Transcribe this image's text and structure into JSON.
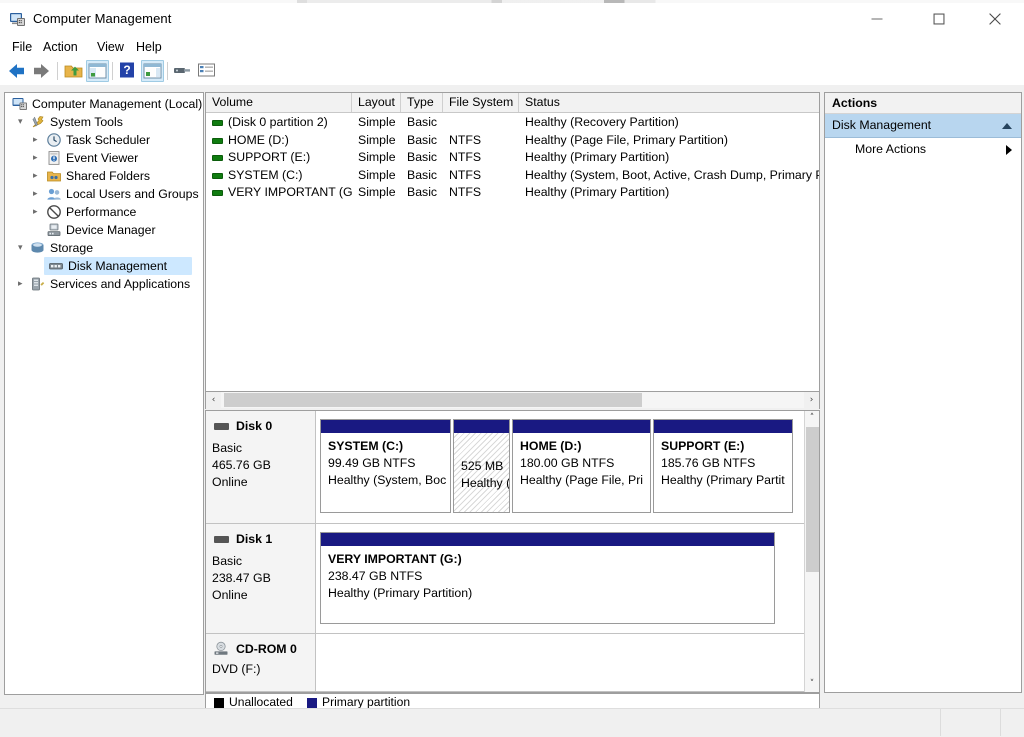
{
  "window": {
    "title": "Computer Management",
    "icon": "computer-management-icon",
    "minimize_label": "—",
    "maximize_label": "□",
    "close_label": "✕"
  },
  "menubar": {
    "items": [
      {
        "label": "File"
      },
      {
        "label": "Action"
      },
      {
        "label": "View"
      },
      {
        "label": "Help"
      }
    ]
  },
  "toolbar": {
    "buttons": [
      {
        "name": "back-icon"
      },
      {
        "name": "forward-icon"
      },
      {
        "name": "up-folder-icon"
      },
      {
        "name": "show-hide-console-tree-icon"
      },
      {
        "name": "help-icon"
      },
      {
        "name": "show-hide-action-pane-icon"
      },
      {
        "name": "properties-icon"
      },
      {
        "name": "list-view-icon"
      }
    ]
  },
  "tree": {
    "root": {
      "label": "Computer Management (Local)",
      "icon": "computer-icon"
    },
    "items": [
      {
        "label": "System Tools",
        "icon": "system-tools-icon",
        "indent": 1,
        "expander": "expanded",
        "selected": false
      },
      {
        "label": "Task Scheduler",
        "icon": "task-scheduler-icon",
        "indent": 2,
        "expander": "collapsed",
        "selected": false
      },
      {
        "label": "Event Viewer",
        "icon": "event-viewer-icon",
        "indent": 2,
        "expander": "collapsed",
        "selected": false
      },
      {
        "label": "Shared Folders",
        "icon": "shared-folders-icon",
        "indent": 2,
        "expander": "collapsed",
        "selected": false
      },
      {
        "label": "Local Users and Groups",
        "icon": "local-users-icon",
        "indent": 2,
        "expander": "collapsed",
        "selected": false
      },
      {
        "label": "Performance",
        "icon": "performance-icon",
        "indent": 2,
        "expander": "collapsed",
        "selected": false
      },
      {
        "label": "Device Manager",
        "icon": "device-manager-icon",
        "indent": 2,
        "expander": "none",
        "selected": false
      },
      {
        "label": "Storage",
        "icon": "storage-icon",
        "indent": 1,
        "expander": "expanded",
        "selected": false
      },
      {
        "label": "Disk Management",
        "icon": "disk-management-icon",
        "indent": 2,
        "expander": "none",
        "selected": true
      },
      {
        "label": "Services and Applications",
        "icon": "services-icon",
        "indent": 1,
        "expander": "collapsed",
        "selected": false
      }
    ]
  },
  "volume_list": {
    "columns": [
      {
        "label": "Volume"
      },
      {
        "label": "Layout"
      },
      {
        "label": "Type"
      },
      {
        "label": "File System"
      },
      {
        "label": "Status"
      }
    ],
    "rows": [
      {
        "volume": "(Disk 0 partition 2)",
        "layout": "Simple",
        "type": "Basic",
        "fs": "",
        "status": "Healthy (Recovery Partition)"
      },
      {
        "volume": "HOME (D:)",
        "layout": "Simple",
        "type": "Basic",
        "fs": "NTFS",
        "status": "Healthy (Page File, Primary Partition)"
      },
      {
        "volume": "SUPPORT (E:)",
        "layout": "Simple",
        "type": "Basic",
        "fs": "NTFS",
        "status": "Healthy (Primary Partition)"
      },
      {
        "volume": "SYSTEM (C:)",
        "layout": "Simple",
        "type": "Basic",
        "fs": "NTFS",
        "status": "Healthy (System, Boot, Active, Crash Dump, Primary P"
      },
      {
        "volume": "VERY IMPORTANT (G:)",
        "layout": "Simple",
        "type": "Basic",
        "fs": "NTFS",
        "status": "Healthy (Primary Partition)"
      }
    ]
  },
  "disks": [
    {
      "name": "Disk 0",
      "type": "Basic",
      "capacity": "465.76 GB",
      "state": "Online",
      "partitions": [
        {
          "name": "SYSTEM  (C:)",
          "size": "99.49 GB NTFS",
          "status": "Healthy (System, Boc",
          "style": "primary"
        },
        {
          "name": "",
          "size": "525 MB",
          "status": "Healthy (F",
          "style": "recovery"
        },
        {
          "name": "HOME  (D:)",
          "size": "180.00 GB NTFS",
          "status": "Healthy (Page File, Pri",
          "style": "primary"
        },
        {
          "name": "SUPPORT  (E:)",
          "size": "185.76 GB NTFS",
          "status": "Healthy (Primary Partit",
          "style": "primary"
        }
      ]
    },
    {
      "name": "Disk 1",
      "type": "Basic",
      "capacity": "238.47 GB",
      "state": "Online",
      "partitions": [
        {
          "name": "VERY IMPORTANT  (G:)",
          "size": "238.47 GB NTFS",
          "status": "Healthy (Primary Partition)",
          "style": "primary"
        }
      ]
    },
    {
      "name": "CD-ROM 0",
      "type": "DVD (F:)",
      "capacity": "",
      "state": "",
      "partitions": []
    }
  ],
  "legend": [
    {
      "label": "Unallocated",
      "color": "#000000"
    },
    {
      "label": "Primary partition",
      "color": "#191982"
    }
  ],
  "actions": {
    "header": "Actions",
    "section": {
      "label": "Disk Management",
      "expander": "collapse-arrow"
    },
    "items": [
      {
        "label": "More Actions",
        "expander": "submenu-arrow"
      }
    ]
  },
  "scrollbars": {
    "h_left": "‹",
    "h_right": "›",
    "v_up": "˄",
    "v_down": "˅"
  },
  "colors": {
    "selection": "#cde8ff",
    "partition_header": "#191982",
    "actions_section": "#b8d6ef",
    "volume_icon": "#107c10"
  }
}
